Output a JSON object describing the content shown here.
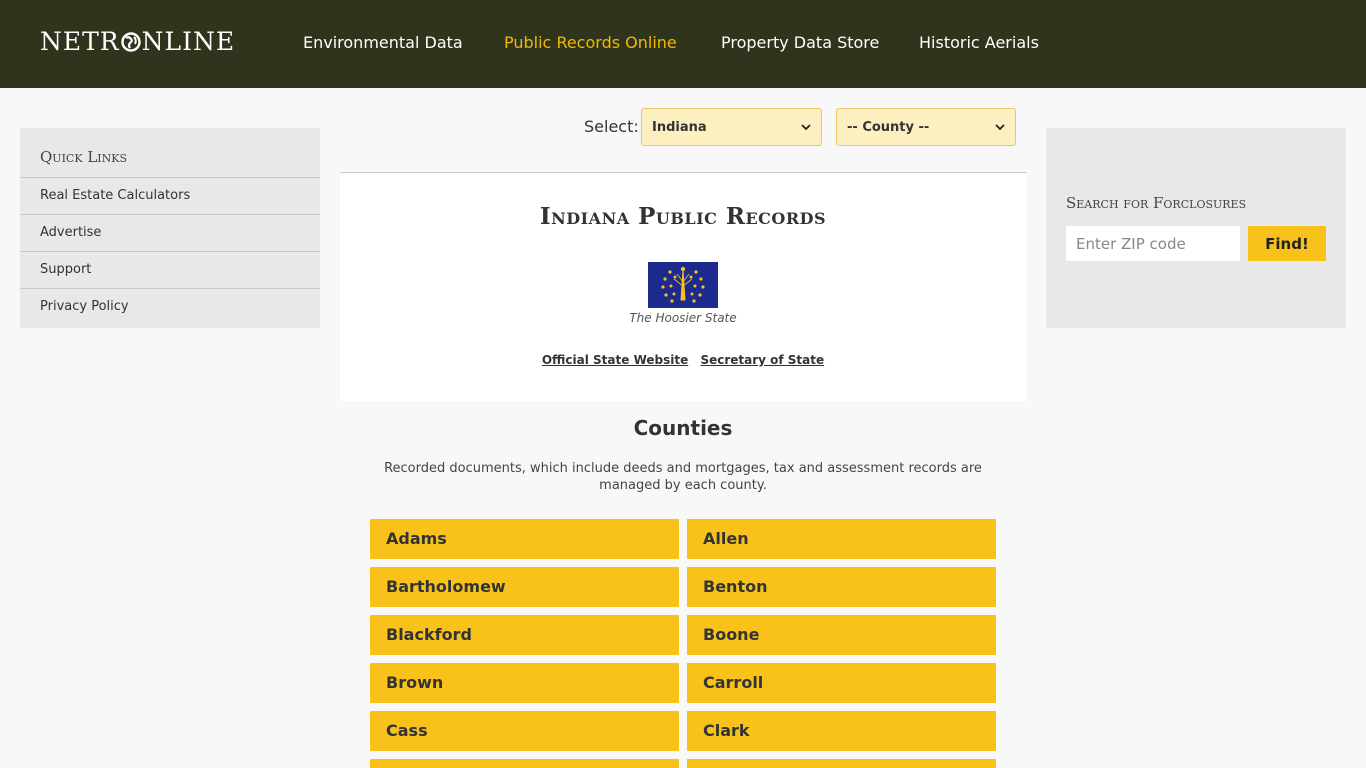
{
  "header": {
    "logo_left": "NETR",
    "logo_right": "NLINE",
    "nav": [
      {
        "label": "Environmental Data"
      },
      {
        "label": "Public Records Online"
      },
      {
        "label": "Property Data Store"
      },
      {
        "label": "Historic Aerials"
      }
    ],
    "active_nav": "Public Records Online"
  },
  "quick_links": {
    "title": "Quick Links",
    "items": [
      {
        "label": "Real Estate Calculators"
      },
      {
        "label": "Advertise"
      },
      {
        "label": "Support"
      },
      {
        "label": "Privacy Policy"
      }
    ]
  },
  "foreclosures": {
    "title": "Search for Forclosures",
    "zip_placeholder": "Enter ZIP code",
    "find_label": "Find!"
  },
  "selector": {
    "label": "Select:",
    "state_value": "Indiana",
    "county_value": "-- County --"
  },
  "main": {
    "title": "Indiana Public Records",
    "nickname": "The Hoosier State",
    "links": [
      {
        "label": "Official State Website"
      },
      {
        "label": "Secretary of State"
      }
    ],
    "counties_title": "Counties",
    "counties_desc": "Recorded documents, which include deeds and mortgages, tax and assessment records are managed by each county.",
    "counties": [
      {
        "name": "Adams"
      },
      {
        "name": "Allen"
      },
      {
        "name": "Bartholomew"
      },
      {
        "name": "Benton"
      },
      {
        "name": "Blackford"
      },
      {
        "name": "Boone"
      },
      {
        "name": "Brown"
      },
      {
        "name": "Carroll"
      },
      {
        "name": "Cass"
      },
      {
        "name": "Clark"
      }
    ]
  },
  "colors": {
    "header_bg": "#2f351c",
    "accent": "#f8c21a",
    "active_nav": "#f5b800",
    "flag_blue": "#1d2b8f",
    "flag_gold": "#f4c41e"
  }
}
